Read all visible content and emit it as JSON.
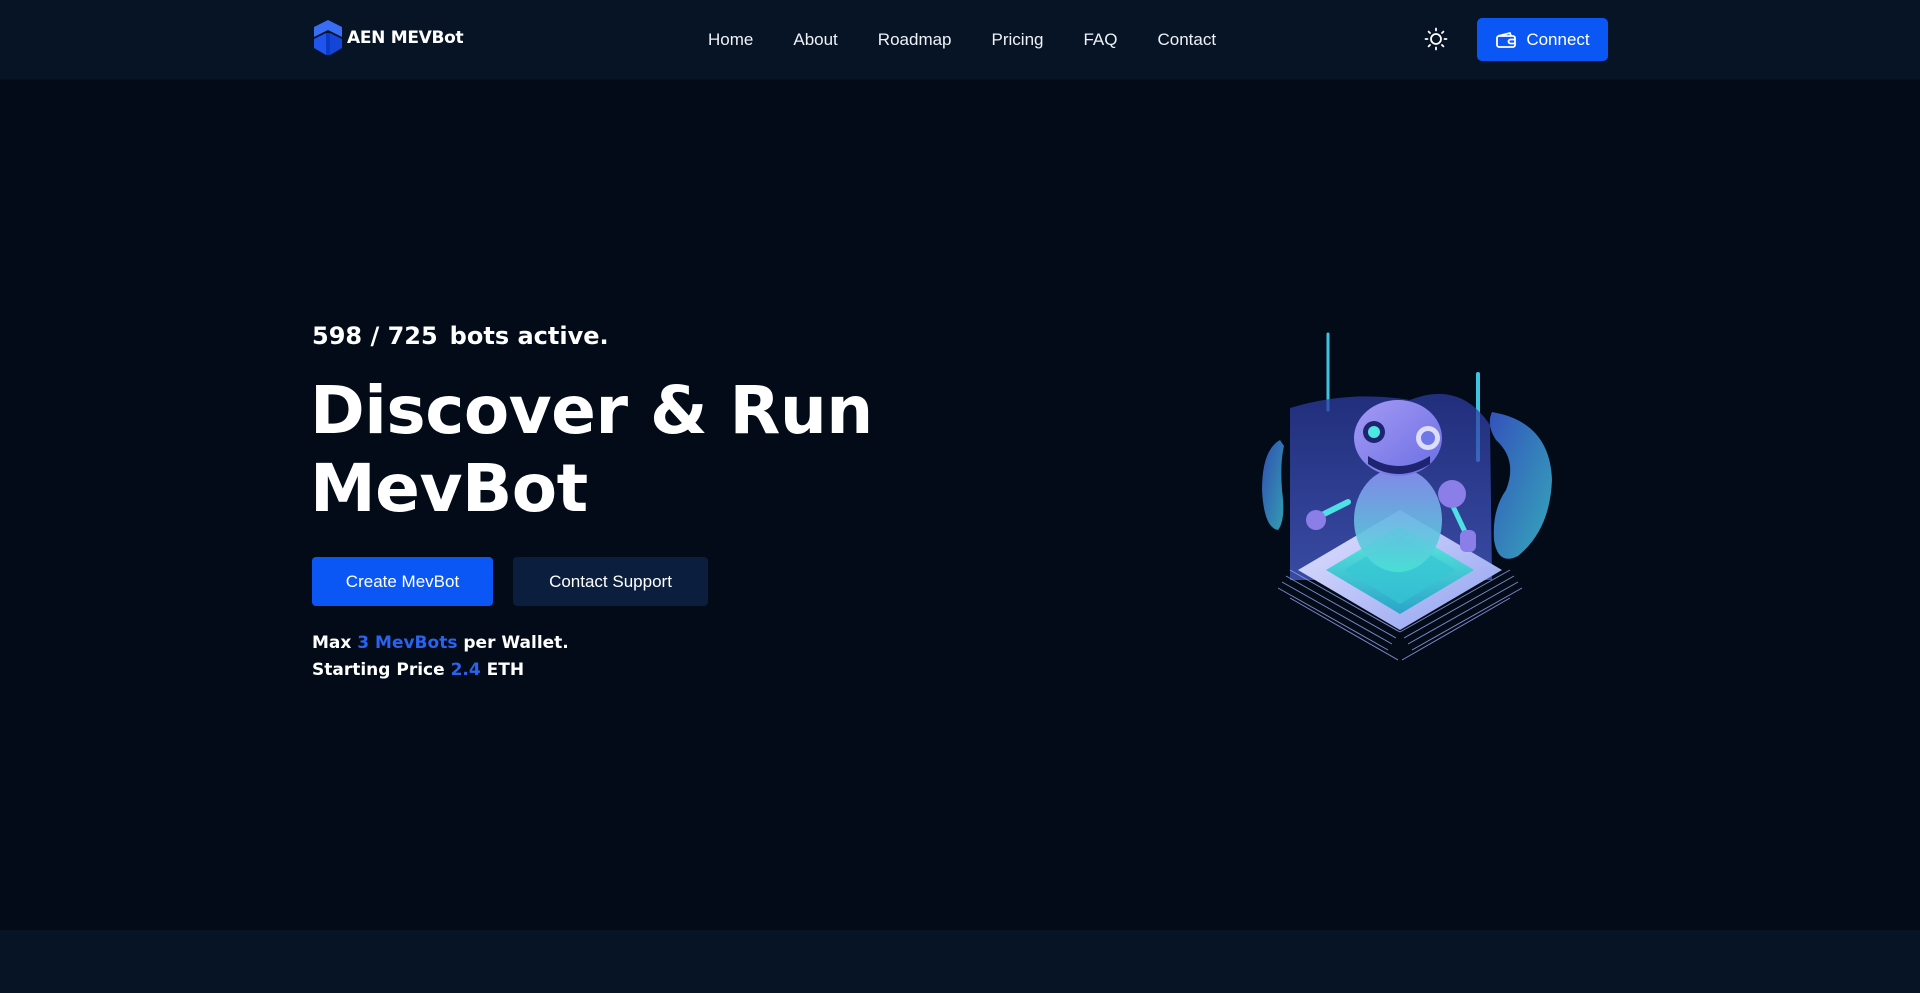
{
  "brand": {
    "name": "AEN MEVBot",
    "logo_icon": "cube-logo-icon",
    "accent_color": "#0b57f5"
  },
  "nav": {
    "items": [
      {
        "label": "Home"
      },
      {
        "label": "About"
      },
      {
        "label": "Roadmap"
      },
      {
        "label": "Pricing"
      },
      {
        "label": "FAQ"
      },
      {
        "label": "Contact"
      }
    ],
    "theme_icon": "sun-icon",
    "connect_label": "Connect",
    "connect_icon": "wallet-icon"
  },
  "hero": {
    "bots_count": "598 / 725",
    "bots_suffix": "bots active.",
    "title_line1": "Discover & Run",
    "title_line2": "MevBot",
    "primary_button": "Create MevBot",
    "secondary_button": "Contact Support",
    "info_max_prefix": "Max ",
    "info_max_value": "3 MevBots",
    "info_max_suffix": " per Wallet.",
    "info_price_prefix": "Starting Price ",
    "info_price_value": "2.4",
    "info_price_suffix": " ETH",
    "illustration": "robot-on-chip-illustration"
  },
  "colors": {
    "background": "#020b17",
    "nav_background": "#071426",
    "secondary_button": "#0b1e3d",
    "highlight_text": "#2a63f0"
  }
}
